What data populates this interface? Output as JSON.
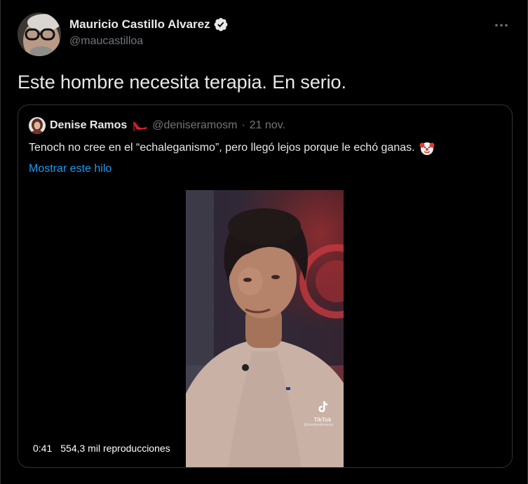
{
  "tweet": {
    "author": {
      "name": "Mauricio Castillo Alvarez",
      "handle": "@maucastilloa",
      "verified": true
    },
    "more_icon": "more-horizontal-icon",
    "text": "Este hombre necesita terapia. En serio."
  },
  "quote": {
    "author": {
      "name": "Denise Ramos",
      "emoji": "high-heel-icon",
      "handle": "@deniseramosm",
      "separator": "·",
      "date": "21 nov."
    },
    "text": "Tenoch no cree en el “echaleganismo”, pero llegó lejos porque le echó ganas.",
    "text_emoji": "clown-face-icon",
    "show_thread": "Mostrar este hilo",
    "video": {
      "duration": "0:41",
      "views": "554,3 mil reproducciones",
      "watermark_label": "TikTok",
      "watermark_user": "@hanstandemanta"
    }
  },
  "colors": {
    "background": "#000000",
    "text_primary": "#e7e9ea",
    "text_secondary": "#71767b",
    "link": "#1d9bf0",
    "border": "#2f3336"
  }
}
